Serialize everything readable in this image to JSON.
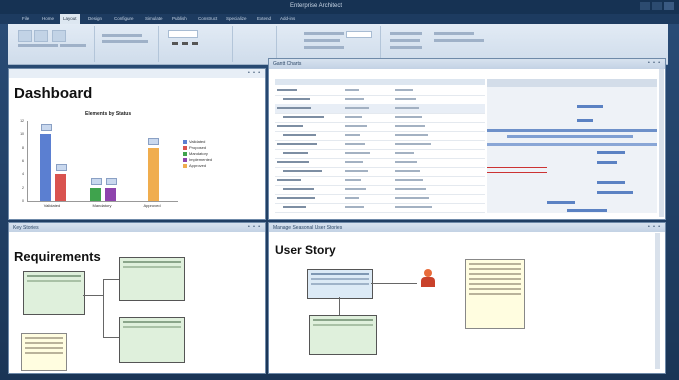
{
  "window": {
    "title": "Enterprise Architect"
  },
  "menu": {
    "items": [
      "File",
      "Home",
      "Layout",
      "Design",
      "Configure",
      "Simulate",
      "Publish",
      "Construct",
      "Specialize",
      "Extend",
      "Add-ins"
    ],
    "active_index": 2
  },
  "dashboard": {
    "heading": "Dashboard",
    "chart_data": {
      "type": "bar",
      "title": "Elements by Status",
      "categories": [
        "Validated",
        "Mandatory",
        "Approved"
      ],
      "series": [
        {
          "name": "Validated",
          "color": "#5b7fd1",
          "values": [
            10,
            0,
            0
          ]
        },
        {
          "name": "Proposed",
          "color": "#d9534f",
          "values": [
            4,
            0,
            0
          ]
        },
        {
          "name": "Mandatory",
          "color": "#3fa34d",
          "values": [
            0,
            2,
            0
          ]
        },
        {
          "name": "Implemented",
          "color": "#8e44ad",
          "values": [
            0,
            2,
            0
          ]
        },
        {
          "name": "Approved",
          "color": "#f0ad4e",
          "values": [
            0,
            0,
            8
          ]
        }
      ],
      "ylim": [
        0,
        12
      ],
      "yticks": [
        "12",
        "10",
        "8",
        "6",
        "4",
        "2",
        "0"
      ],
      "legend_position": "right"
    }
  },
  "gantt_panel": {
    "title": "Gantt Charts"
  },
  "req_panel": {
    "title": "Key Stories",
    "heading": "Requirements"
  },
  "story_panel": {
    "title": "Manage Seasonal User Stories",
    "heading": "User Story"
  }
}
